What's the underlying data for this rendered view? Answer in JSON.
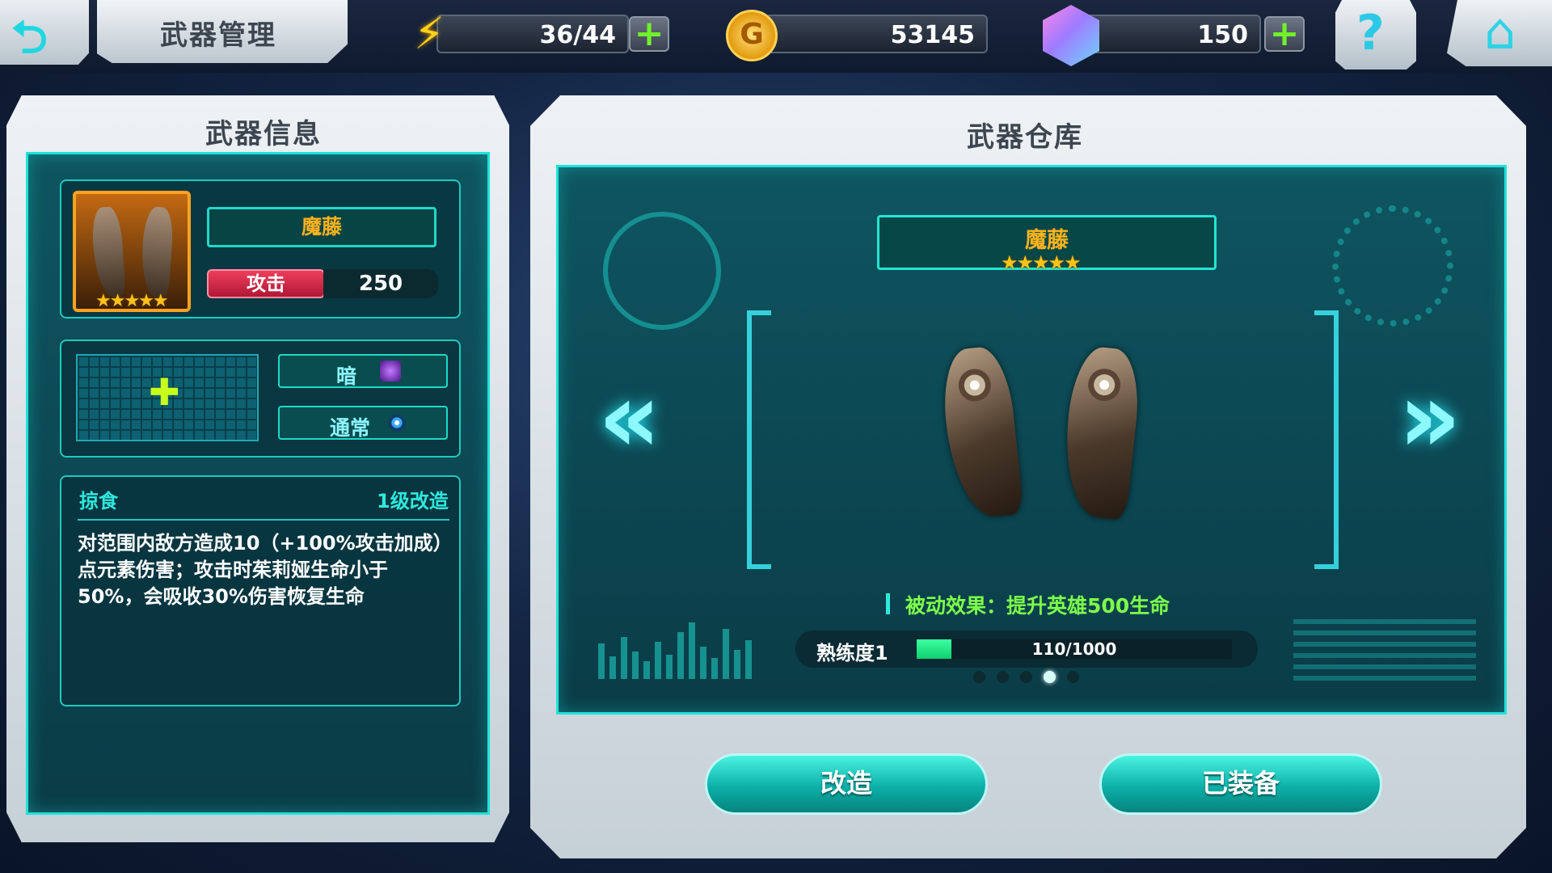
{
  "header": {
    "title": "武器管理",
    "energy": "36/44",
    "gold": "53145",
    "gems": "150"
  },
  "left_panel": {
    "title": "武器信息",
    "weapon_name": "魔藤",
    "stars": "★★★★★",
    "attack_label": "攻击",
    "attack_value": "250",
    "element_tag": "暗",
    "type_tag": "通常",
    "skill_name": "掠食",
    "skill_level": "1级改造",
    "skill_description": "对范围内敌方造成10（+100%攻击加成）点元素伤害；攻击时茱莉娅生命小于50%，会吸收30%伤害恢复生命"
  },
  "right_panel": {
    "title": "武器仓库",
    "weapon_name": "魔藤",
    "stars": "★★★★★",
    "passive": "被动效果：提升英雄500生命",
    "proficiency_label": "熟练度1",
    "proficiency_text": "110/1000",
    "proficiency_progress": 0.11,
    "page_count": 5,
    "page_active": 4,
    "upgrade_button": "改造",
    "equipped_button": "已装备"
  },
  "colors": {
    "accent": "#1ee3d9",
    "gold_star": "#ffc21a",
    "attack_red": "#e0304e",
    "passive_green": "#7dff4a"
  },
  "icons": {
    "back": "back-arrow-icon",
    "energy": "lightning-icon",
    "gold": "gold-coin-icon",
    "gem": "gem-icon",
    "help": "question-icon",
    "home": "home-icon"
  }
}
